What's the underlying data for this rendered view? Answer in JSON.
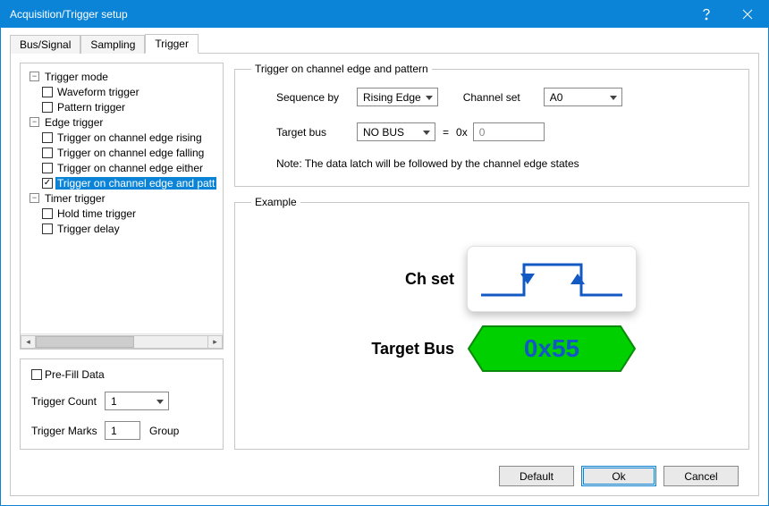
{
  "window": {
    "title": "Acquisition/Trigger setup"
  },
  "tabs": [
    "Bus/Signal",
    "Sampling",
    "Trigger"
  ],
  "active_tab_index": 2,
  "tree": {
    "trigger_mode": {
      "label": "Trigger mode",
      "children": {
        "waveform": {
          "label": "Waveform trigger",
          "checked": false
        },
        "pattern": {
          "label": "Pattern trigger",
          "checked": false
        }
      }
    },
    "edge_trigger": {
      "label": "Edge trigger",
      "children": {
        "rising": {
          "label": "Trigger on channel edge rising",
          "checked": false
        },
        "falling": {
          "label": "Trigger on channel edge falling",
          "checked": false
        },
        "either": {
          "label": "Trigger on channel edge either",
          "checked": false
        },
        "pattern": {
          "label": "Trigger on channel edge and patt",
          "checked": true,
          "selected": true
        }
      }
    },
    "timer_trigger": {
      "label": "Timer trigger",
      "children": {
        "hold": {
          "label": "Hold time trigger",
          "checked": false
        },
        "delay": {
          "label": "Trigger delay",
          "checked": false
        }
      }
    }
  },
  "options": {
    "prefill": {
      "label": "Pre-Fill Data",
      "checked": false
    },
    "trigger_count": {
      "label": "Trigger Count",
      "value": "1"
    },
    "trigger_marks": {
      "label": "Trigger Marks",
      "value": "1",
      "suffix": "Group"
    }
  },
  "settings": {
    "legend": "Trigger on channel edge and pattern",
    "sequence_by": {
      "label": "Sequence by",
      "value": "Rising Edge"
    },
    "channel_set": {
      "label": "Channel set",
      "value": "A0"
    },
    "target_bus": {
      "label": "Target bus",
      "value": "NO BUS"
    },
    "equals": "=",
    "hex_prefix": "0x",
    "hex_value": "0",
    "note": "Note: The data latch will be followed by the channel edge states"
  },
  "example": {
    "legend": "Example",
    "chset_label": "Ch set",
    "target_label": "Target Bus",
    "target_value": "0x55"
  },
  "footer": {
    "default": "Default",
    "ok": "Ok",
    "cancel": "Cancel"
  },
  "glyphs": {
    "minus": "−",
    "left": "◂",
    "right": "▸"
  }
}
